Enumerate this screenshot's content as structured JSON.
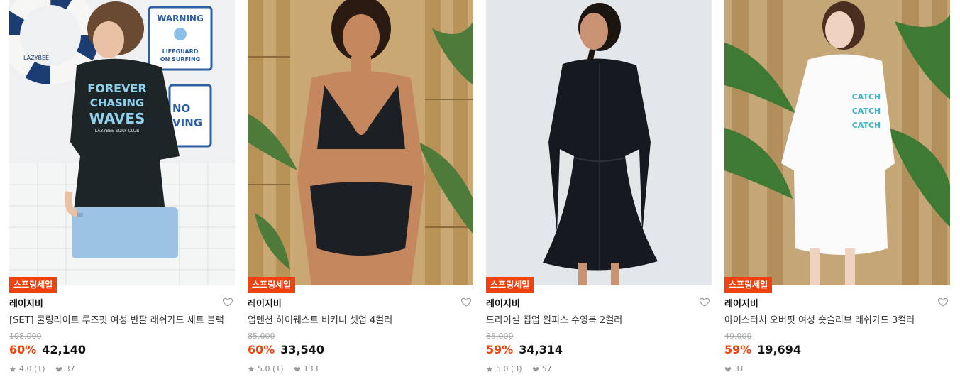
{
  "products": [
    {
      "badge": "스프링세일",
      "brand": "레이지비",
      "name": "[SET] 쿨링라이트 루즈핏 여성 반팔 래쉬가드 세트 블랙",
      "original_price": "108,000",
      "discount": "60%",
      "price": "42,140",
      "rating": "4.0 (1)",
      "likes": "37",
      "image": {
        "sign1_title": "WARNING",
        "sign1_text": "LIFEGUARD",
        "sign1_text2": "ON SURFING",
        "sign2_text": "NO",
        "sign2_text2": "VING",
        "ring_text": "LAZYBEE",
        "shirt_line1": "FOREVER",
        "shirt_line2": "CHASING",
        "shirt_line3": "WAVES",
        "shirt_line4": "LAZYBEE SURF CLUB"
      }
    },
    {
      "badge": "스프링세일",
      "brand": "레이지비",
      "name": "업텐션 하이웨스트 비키니 셋업 4컬러",
      "original_price": "85,000",
      "discount": "60%",
      "price": "33,540",
      "rating": "5.0 (1)",
      "likes": "133"
    },
    {
      "badge": "스프링세일",
      "brand": "레이지비",
      "name": "드라이셀 집업 원피스 수영복 2컬러",
      "original_price": "85,000",
      "discount": "59%",
      "price": "34,314",
      "rating": "5.0 (3)",
      "likes": "57"
    },
    {
      "badge": "스프링세일",
      "brand": "레이지비",
      "name": "아이스터치 오버핏 여성 숏슬리브 래쉬가드 3컬러",
      "original_price": "49,000",
      "discount": "59%",
      "price": "19,694",
      "rating": "",
      "likes": "31",
      "image": {
        "shirt_line1": "CATCH",
        "shirt_line2": "CATCH",
        "shirt_line3": "CATCH"
      }
    }
  ],
  "colors": {
    "badge": "#f0420f",
    "discount": "#f0420f",
    "price": "#111111",
    "muted": "#888888"
  }
}
